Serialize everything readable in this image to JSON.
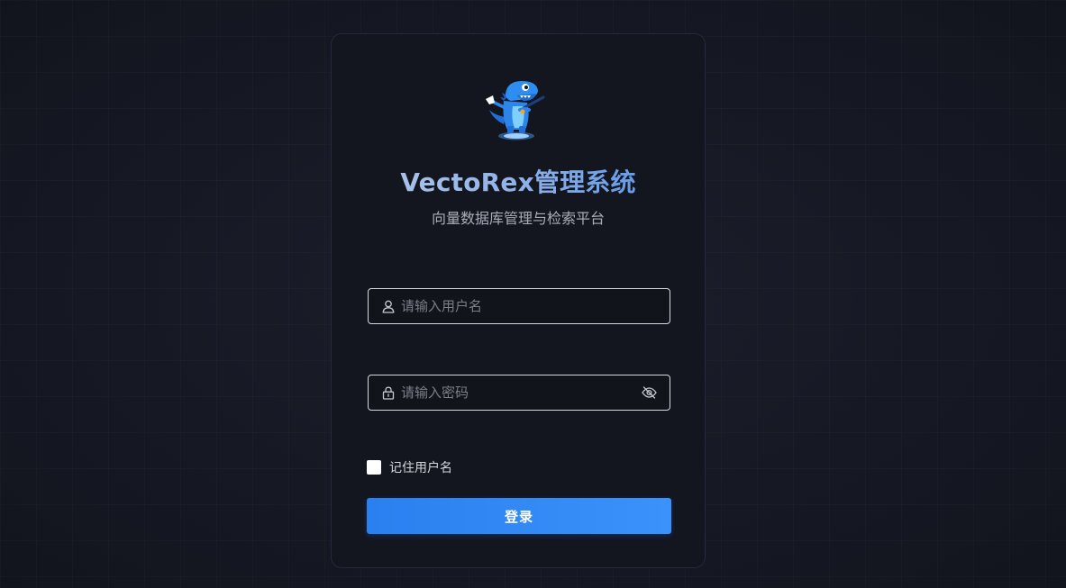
{
  "app": {
    "title": "VectoRex管理系统",
    "subtitle": "向量数据库管理与检索平台",
    "logo_icon": "dinosaur-mascot-logo"
  },
  "login_form": {
    "username_placeholder": "请输入用户名",
    "username_value": "",
    "username_icon": "user-icon",
    "password_placeholder": "请输入密码",
    "password_value": "",
    "password_icon": "lock-icon",
    "password_toggle_icon": "eye-off-icon",
    "remember_label": "记住用户名",
    "remember_checked": false,
    "submit_label": "登录"
  },
  "colors": {
    "background": "#161824",
    "card": "#14161f",
    "primary": "#3b92fb",
    "title_gradient_start": "#b7c9ea",
    "title_gradient_end": "#4f8fe8"
  }
}
